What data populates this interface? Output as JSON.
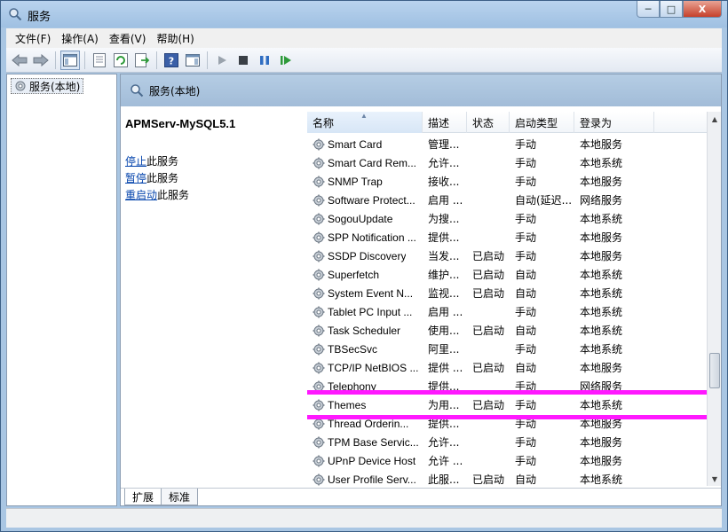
{
  "window": {
    "title": "服务",
    "min_glyph": "─",
    "max_glyph": "□",
    "close_glyph": "X"
  },
  "menu": [
    "文件(F)",
    "操作(A)",
    "查看(V)",
    "帮助(H)"
  ],
  "tree": {
    "item_label": "服务(本地)"
  },
  "main": {
    "header_title": "服务(本地)",
    "selected_service": "APMServ-MySQL5.1",
    "actions": [
      {
        "link": "停止",
        "suffix": "此服务"
      },
      {
        "link": "暂停",
        "suffix": "此服务"
      },
      {
        "link": "重启动",
        "suffix": "此服务"
      }
    ]
  },
  "list": {
    "columns": [
      "名称",
      "描述",
      "状态",
      "启动类型",
      "登录为"
    ],
    "rows": [
      {
        "name": "Smart Card",
        "desc": "管理...",
        "status": "",
        "startup": "手动",
        "logon": "本地服务"
      },
      {
        "name": "Smart Card Rem...",
        "desc": "允许...",
        "status": "",
        "startup": "手动",
        "logon": "本地系统"
      },
      {
        "name": "SNMP Trap",
        "desc": "接收...",
        "status": "",
        "startup": "手动",
        "logon": "本地服务"
      },
      {
        "name": "Software Protect...",
        "desc": "启用 ...",
        "status": "",
        "startup": "自动(延迟...",
        "logon": "网络服务"
      },
      {
        "name": "SogouUpdate",
        "desc": "为搜...",
        "status": "",
        "startup": "手动",
        "logon": "本地系统"
      },
      {
        "name": "SPP Notification ...",
        "desc": "提供...",
        "status": "",
        "startup": "手动",
        "logon": "本地服务"
      },
      {
        "name": "SSDP Discovery",
        "desc": "当发...",
        "status": "已启动",
        "startup": "手动",
        "logon": "本地服务"
      },
      {
        "name": "Superfetch",
        "desc": "维护...",
        "status": "已启动",
        "startup": "自动",
        "logon": "本地系统"
      },
      {
        "name": "System Event N...",
        "desc": "监视...",
        "status": "已启动",
        "startup": "自动",
        "logon": "本地系统"
      },
      {
        "name": "Tablet PC Input ...",
        "desc": "启用 ...",
        "status": "",
        "startup": "手动",
        "logon": "本地系统"
      },
      {
        "name": "Task Scheduler",
        "desc": "使用...",
        "status": "已启动",
        "startup": "自动",
        "logon": "本地系统"
      },
      {
        "name": "TBSecSvc",
        "desc": "阿里...",
        "status": "",
        "startup": "手动",
        "logon": "本地系统"
      },
      {
        "name": "TCP/IP NetBIOS ...",
        "desc": "提供 ...",
        "status": "已启动",
        "startup": "自动",
        "logon": "本地服务"
      },
      {
        "name": "Telephony",
        "desc": "提供...",
        "status": "",
        "startup": "手动",
        "logon": "网络服务"
      },
      {
        "name": "Themes",
        "desc": "为用...",
        "status": "已启动",
        "startup": "手动",
        "logon": "本地系统"
      },
      {
        "name": "Thread Orderin...",
        "desc": "提供...",
        "status": "",
        "startup": "手动",
        "logon": "本地服务"
      },
      {
        "name": "TPM Base Servic...",
        "desc": "允许...",
        "status": "",
        "startup": "手动",
        "logon": "本地服务"
      },
      {
        "name": "UPnP Device Host",
        "desc": "允许 ...",
        "status": "",
        "startup": "手动",
        "logon": "本地服务"
      },
      {
        "name": "User Profile Serv...",
        "desc": "此服...",
        "status": "已启动",
        "startup": "自动",
        "logon": "本地系统"
      }
    ],
    "highlighted_service": "Themes",
    "highlight_color": "#ff18ff"
  },
  "tabs": [
    "扩展",
    "标准"
  ]
}
